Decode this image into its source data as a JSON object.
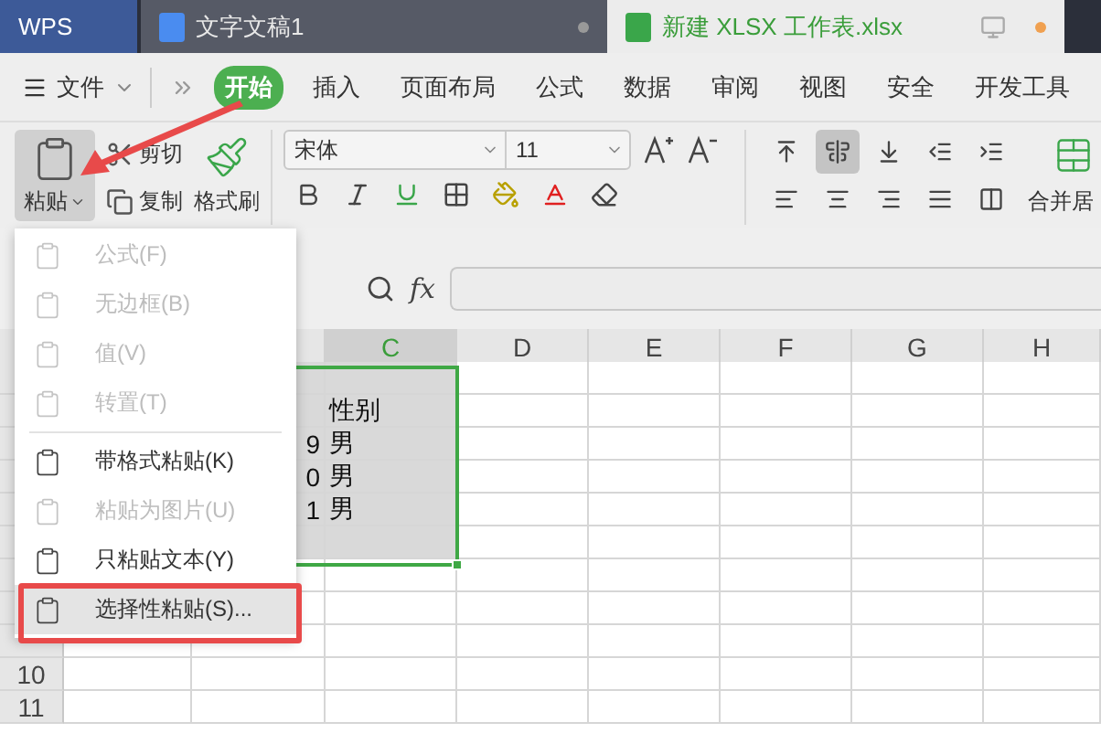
{
  "title_tabs": [
    {
      "kind": "app",
      "label": "WPS",
      "selected": false
    },
    {
      "kind": "doc",
      "label": "文字文稿1",
      "selected": false
    },
    {
      "kind": "sheet",
      "label": "新建 XLSX 工作表.xlsx",
      "selected": true
    }
  ],
  "menu_bar": {
    "file": "文件",
    "tabs": [
      {
        "label": "开始",
        "selected": true
      },
      {
        "label": "插入",
        "selected": false
      },
      {
        "label": "页面布局",
        "selected": false
      },
      {
        "label": "公式",
        "selected": false
      },
      {
        "label": "数据",
        "selected": false
      },
      {
        "label": "审阅",
        "selected": false
      },
      {
        "label": "视图",
        "selected": false
      },
      {
        "label": "安全",
        "selected": false
      },
      {
        "label": "开发工具",
        "selected": false
      }
    ]
  },
  "ribbon": {
    "paste": "粘贴",
    "cut": "剪切",
    "copy": "复制",
    "format_painter": "格式刷",
    "font": "宋体",
    "fx": "fx",
    "font_size": "11",
    "merge": "合并居",
    "align": [
      {
        "selected": false
      },
      {
        "selected": true
      },
      {
        "selected": false
      },
      {
        "selected": false
      },
      {
        "selected": false
      },
      {
        "selected": false
      },
      {
        "selected": false
      },
      {
        "selected": false
      },
      {
        "selected": false
      },
      {
        "selected": false
      }
    ]
  },
  "paste_menu": {
    "items": [
      {
        "label": "公式(F)",
        "disabled": true,
        "highlighted": false,
        "divider_before": false
      },
      {
        "label": "无边框(B)",
        "disabled": true,
        "highlighted": false,
        "divider_before": false
      },
      {
        "label": "值(V)",
        "disabled": true,
        "highlighted": false,
        "divider_before": false
      },
      {
        "label": "转置(T)",
        "disabled": true,
        "highlighted": false,
        "divider_before": false
      },
      {
        "label": "带格式粘贴(K)",
        "disabled": false,
        "highlighted": false,
        "divider_before": true
      },
      {
        "label": "粘贴为图片(U)",
        "disabled": true,
        "highlighted": false,
        "divider_before": false
      },
      {
        "label": "只粘贴文本(Y)",
        "disabled": false,
        "highlighted": false,
        "divider_before": false
      },
      {
        "label": "选择性粘贴(S)...",
        "disabled": false,
        "highlighted": true,
        "divider_before": false
      }
    ]
  },
  "grid": {
    "columns": [
      {
        "label": "C",
        "selected": true
      },
      {
        "label": "D",
        "selected": false
      },
      {
        "label": "E",
        "selected": false
      },
      {
        "label": "F",
        "selected": false
      },
      {
        "label": "G",
        "selected": false
      },
      {
        "label": "H",
        "selected": false
      }
    ],
    "rows": [
      {
        "selected": true
      },
      {
        "selected": true,
        "c": "性别"
      },
      {
        "selected": true,
        "b": "9",
        "c": "男"
      },
      {
        "selected": true,
        "b": "0",
        "c": "男"
      },
      {
        "selected": true,
        "b": "1",
        "c": "男"
      },
      {
        "selected": true
      },
      {
        "selected": false
      },
      {
        "selected": false
      },
      {
        "selected": false
      },
      {
        "selected": false,
        "number": "10"
      },
      {
        "selected": false,
        "number": "11"
      }
    ]
  }
}
